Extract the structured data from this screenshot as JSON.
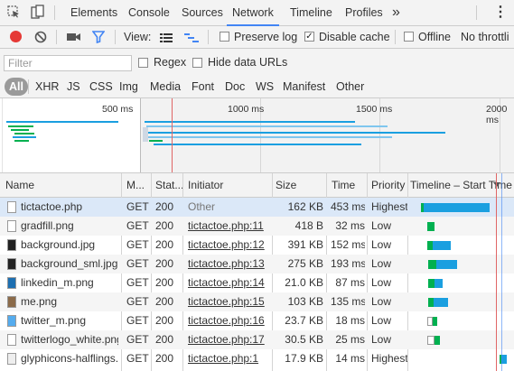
{
  "tabs": [
    "Elements",
    "Console",
    "Sources",
    "Network",
    "Timeline",
    "Profiles"
  ],
  "more_tabs_glyph": "»",
  "menu_glyph": "⋮",
  "toolbar": {
    "view_label": "View:",
    "preserve_log": "Preserve log",
    "disable_cache": "Disable cache",
    "offline": "Offline",
    "throttle": "No throttli"
  },
  "filter": {
    "placeholder": "Filter",
    "regex": "Regex",
    "hide_data_urls": "Hide data URLs"
  },
  "types": [
    "All",
    "XHR",
    "JS",
    "CSS",
    "Img",
    "Media",
    "Font",
    "Doc",
    "WS",
    "Manifest",
    "Other"
  ],
  "overview": {
    "labels": [
      "500 ms",
      "1000 ms",
      "1500 ms",
      "2000 ms"
    ]
  },
  "columns": [
    "Name",
    "M...",
    "Stat...",
    "Initiator",
    "Size",
    "Time",
    "Priority",
    "Timeline – Start Time"
  ],
  "colors": {
    "accent": "#4285f4",
    "record": "#e53935",
    "waiting": "#00b050",
    "download": "#1a9fe0",
    "load_line": "#e06666"
  },
  "rows": [
    {
      "name": "tictactoe.php",
      "method": "GET",
      "status": "200",
      "initiator": "Other",
      "initiator_link": false,
      "size": "162 KB",
      "time": "453 ms",
      "priority": "Highest",
      "icon": "document-icon"
    },
    {
      "name": "gradfill.png",
      "method": "GET",
      "status": "200",
      "initiator": "tictactoe.php:11",
      "initiator_link": true,
      "size": "418 B",
      "time": "32 ms",
      "priority": "Low",
      "icon": "image-icon"
    },
    {
      "name": "background.jpg",
      "method": "GET",
      "status": "200",
      "initiator": "tictactoe.php:12",
      "initiator_link": true,
      "size": "391 KB",
      "time": "152 ms",
      "priority": "Low",
      "icon": "image-icon"
    },
    {
      "name": "background_sml.jpg",
      "method": "GET",
      "status": "200",
      "initiator": "tictactoe.php:13",
      "initiator_link": true,
      "size": "275 KB",
      "time": "193 ms",
      "priority": "Low",
      "icon": "image-icon"
    },
    {
      "name": "linkedin_m.png",
      "method": "GET",
      "status": "200",
      "initiator": "tictactoe.php:14",
      "initiator_link": true,
      "size": "21.0 KB",
      "time": "87 ms",
      "priority": "Low",
      "icon": "image-icon"
    },
    {
      "name": "me.png",
      "method": "GET",
      "status": "200",
      "initiator": "tictactoe.php:15",
      "initiator_link": true,
      "size": "103 KB",
      "time": "135 ms",
      "priority": "Low",
      "icon": "image-icon"
    },
    {
      "name": "twitter_m.png",
      "method": "GET",
      "status": "200",
      "initiator": "tictactoe.php:16",
      "initiator_link": true,
      "size": "23.7 KB",
      "time": "18 ms",
      "priority": "Low",
      "icon": "image-icon"
    },
    {
      "name": "twitterlogo_white.png",
      "method": "GET",
      "status": "200",
      "initiator": "tictactoe.php:17",
      "initiator_link": true,
      "size": "30.5 KB",
      "time": "25 ms",
      "priority": "Low",
      "icon": "image-icon"
    },
    {
      "name": "glyphicons-halflings...",
      "method": "GET",
      "status": "200",
      "initiator": "tictactoe.php:1",
      "initiator_link": true,
      "size": "17.9 KB",
      "time": "14 ms",
      "priority": "Highest",
      "icon": "font-icon"
    }
  ]
}
